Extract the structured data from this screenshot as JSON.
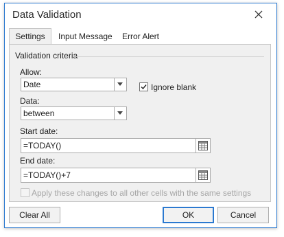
{
  "dialog": {
    "title": "Data Validation"
  },
  "tabs": [
    {
      "label": "Settings",
      "active": true
    },
    {
      "label": "Input Message",
      "active": false
    },
    {
      "label": "Error Alert",
      "active": false
    }
  ],
  "criteria": {
    "legend": "Validation criteria",
    "allow_label": "Allow:",
    "allow_value": "Date",
    "ignore_blank_label": "Ignore blank",
    "ignore_blank_checked": true,
    "data_label": "Data:",
    "data_value": "between",
    "start_label": "Start date:",
    "start_value": "=TODAY()",
    "end_label": "End date:",
    "end_value": "=TODAY()+7",
    "apply_all_label": "Apply these changes to all other cells with the same settings",
    "apply_all_checked": false,
    "apply_all_enabled": false
  },
  "buttons": {
    "clear_all": "Clear All",
    "ok": "OK",
    "cancel": "Cancel"
  },
  "icons": {
    "close": "close-icon",
    "dropdown": "chevron-down-icon",
    "cell_reference": "cell-reference-icon",
    "check": "check-icon"
  }
}
